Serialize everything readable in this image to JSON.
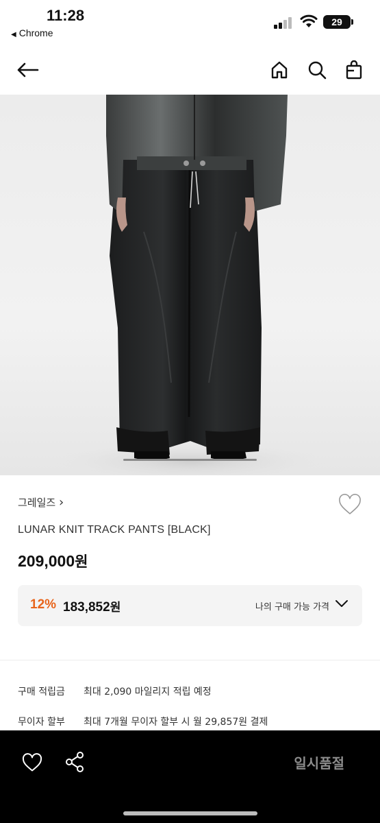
{
  "status_bar": {
    "time": "11:28",
    "back_app": "Chrome",
    "battery": "29"
  },
  "nav": {
    "icons": [
      "back-arrow-icon",
      "home-icon",
      "search-icon",
      "shopping-bag-icon"
    ]
  },
  "product": {
    "brand": "그레일즈",
    "brand_arrow": "›",
    "name": "LUNAR KNIT TRACK PANTS [BLACK]",
    "price": "209,000",
    "currency": "원",
    "image_progress": 0.35
  },
  "discount": {
    "rate": "12%",
    "price": "183,852",
    "currency": "원",
    "my_price_label": "나의 구매 가능 가격",
    "accent_color": "#e8641b"
  },
  "info": [
    {
      "label": "구매 적립금",
      "value": "최대 2,090 마일리지 적립 예정"
    },
    {
      "label": "무이자 할부",
      "value": "최대 7개월 무이자 할부 시 월 29,857원 결제"
    }
  ],
  "bottom_bar": {
    "soldout_label": "일시품절"
  }
}
